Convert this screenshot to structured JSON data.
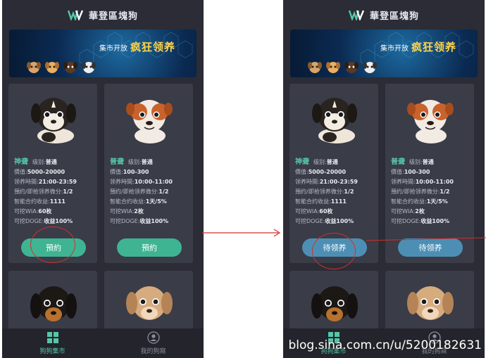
{
  "app": {
    "title": "華登區塊狗"
  },
  "banner": {
    "sub": "集市开放",
    "main": "疯狂领养"
  },
  "cards": [
    {
      "name": "神聋",
      "level_label": "级别:",
      "level": "普通",
      "rows": [
        {
          "label": "價值:",
          "value": "5000-20000"
        },
        {
          "label": "领养時間:",
          "value": "21:00-23:59"
        },
        {
          "label": "預约/即抢领养微分:",
          "value": "1/2"
        },
        {
          "label": "智能合约收益:",
          "value": "1111"
        },
        {
          "label": "可挖WIA:",
          "value": "60枚"
        },
        {
          "label": "可挖DOGE:",
          "value": "收益100%"
        }
      ]
    },
    {
      "name": "普聋",
      "level_label": "级别:",
      "level": "普通",
      "rows": [
        {
          "label": "價值:",
          "value": "100-300"
        },
        {
          "label": "领养時間:",
          "value": "10:00-11:00"
        },
        {
          "label": "預约/即抢领养微分:",
          "value": "1/2"
        },
        {
          "label": "智能合约收益:",
          "value": "1天/5%"
        },
        {
          "label": "可挖WIA:",
          "value": "2枚"
        },
        {
          "label": "可挖DOGE:",
          "value": "收益100%"
        }
      ]
    }
  ],
  "buttons": {
    "left": "預約",
    "right": "待领养"
  },
  "tabs": [
    {
      "label": "狗狗集市"
    },
    {
      "label": "我的狗窩"
    }
  ],
  "watermark": "blog.sina.com.cn/u/5200182631",
  "colors": {
    "accent": "#3fb493",
    "pending": "#4d8fb4",
    "annotation": "#d0312d"
  }
}
